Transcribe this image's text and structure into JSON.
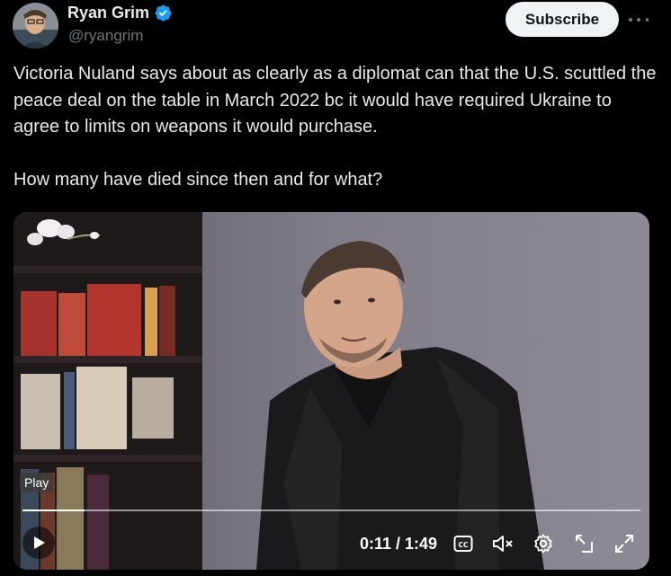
{
  "author": {
    "display_name": "Ryan Grim",
    "handle": "@ryangrim",
    "avatar_icon": "avatar",
    "verified_icon": "verified-badge-icon",
    "verified_color": "#1d9bf0"
  },
  "header": {
    "subscribe_label": "Subscribe",
    "more_icon": "more-options-icon"
  },
  "tweet": {
    "paragraphs": [
      "Victoria Nuland says about as clearly as a diplomat can that the U.S. scuttled the peace deal on the table in March 2022 bc it would have required Ukraine to agree to limits on weapons it would purchase.",
      "How many have died since then and for what?"
    ]
  },
  "video": {
    "tooltip": "Play",
    "current_time": "0:11",
    "duration": "1:49",
    "time_display": "0:11 / 1:49",
    "progress_fraction": 0.1,
    "controls": [
      "play-icon",
      "captions-icon",
      "mute-icon",
      "settings-icon",
      "pop-out-icon",
      "fullscreen-icon"
    ]
  }
}
